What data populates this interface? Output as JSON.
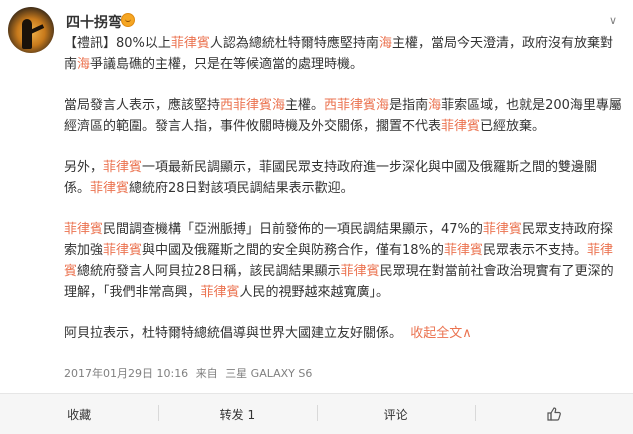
{
  "post": {
    "username": "四十拐弯",
    "badge_icon": "emoji-badge-icon",
    "menu_icon": "chevron-down-icon",
    "paragraphs": [
      [
        {
          "t": "【禮訊】80%以上"
        },
        {
          "t": "菲律賓",
          "hl": true
        },
        {
          "t": "人認為總統杜特爾特應堅持南"
        },
        {
          "t": "海",
          "hl": true
        },
        {
          "t": "主權，當局今天澄清，政府沒有放棄對南"
        },
        {
          "t": "海",
          "hl": true
        },
        {
          "t": "爭議島礁的主權，只是在等候適當的處理時機。"
        }
      ],
      [
        {
          "t": "當局發言人表示，應該堅持"
        },
        {
          "t": "西菲律賓海",
          "hl": true
        },
        {
          "t": "主權。"
        },
        {
          "t": "西菲律賓海",
          "hl": true
        },
        {
          "t": "是指南"
        },
        {
          "t": "海",
          "hl": true
        },
        {
          "t": "菲索區域，也就是200海里專屬經濟區的範圍。發言人指，事件攸關時機及外交關係，擱置不代表"
        },
        {
          "t": "菲律賓",
          "hl": true
        },
        {
          "t": "已經放棄。"
        }
      ],
      [
        {
          "t": "另外，"
        },
        {
          "t": "菲律賓",
          "hl": true
        },
        {
          "t": "一項最新民調顯示，菲國民眾支持政府進一步深化與中國及俄羅斯之間的雙邊關係。"
        },
        {
          "t": "菲律賓",
          "hl": true
        },
        {
          "t": "總統府28日對該項民調結果表示歡迎。"
        }
      ],
      [
        {
          "t": "菲律賓",
          "hl": true
        },
        {
          "t": "民間調查機構「亞洲脈搏」日前發佈的一項民調結果顯示，47%的"
        },
        {
          "t": "菲律賓",
          "hl": true
        },
        {
          "t": "民眾支持政府探索加強"
        },
        {
          "t": "菲律賓",
          "hl": true
        },
        {
          "t": "與中國及俄羅斯之間的安全與防務合作，僅有18%的"
        },
        {
          "t": "菲律賓",
          "hl": true
        },
        {
          "t": "民眾表示不支持。"
        },
        {
          "t": "菲律賓",
          "hl": true
        },
        {
          "t": "總統府發言人阿貝拉28日稱，該民調結果顯示"
        },
        {
          "t": "菲律賓",
          "hl": true
        },
        {
          "t": "民眾現在對當前社會政治現實有了更深的理解，「我們非常高興，"
        },
        {
          "t": "菲律賓",
          "hl": true
        },
        {
          "t": "人民的視野越來越寬廣」。"
        }
      ],
      [
        {
          "t": "阿貝拉表示，杜特爾特總統倡導與世界大國建立友好關係。"
        }
      ]
    ],
    "more_label": "收起全文",
    "more_arrow": "∧",
    "date": "2017年01月29日 10:16",
    "source_prefix": "来自",
    "source_device": "三星 GALAXY S6"
  },
  "actions": {
    "favorite": "收藏",
    "repost": "转发 1",
    "comment": "评论",
    "like_icon": "thumbs-up-icon"
  },
  "colors": {
    "highlight": "#eb7350",
    "text": "#333333",
    "meta": "#808080",
    "action_bar": "#f6f6f6"
  }
}
